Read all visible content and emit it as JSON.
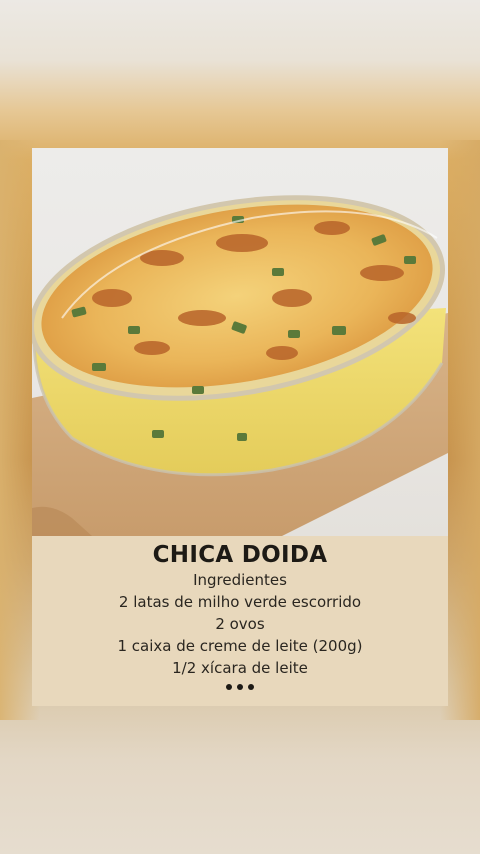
{
  "recipe": {
    "title": "CHICA DOIDA",
    "ingredients_heading": "Ingredientes",
    "ingredients": [
      "2 latas de milho verde escorrido",
      "2 ovos",
      "1 caixa de creme de leite (200g)",
      "1/2 xícara de leite"
    ]
  },
  "photo": {
    "subject": "casserole-dish-image"
  },
  "more_indicator": {
    "icon": "more-dots-icon"
  },
  "colors": {
    "caption_background": "#e8d8bc",
    "text": "#1d1a15",
    "backdrop_accent": "#d4a45a"
  }
}
